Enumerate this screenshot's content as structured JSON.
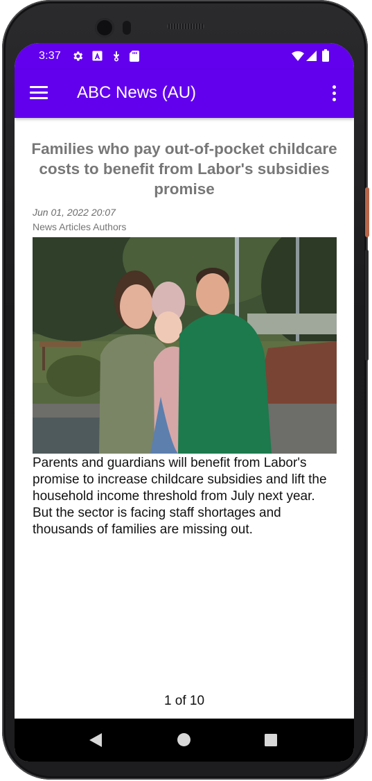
{
  "status_bar": {
    "time": "3:37",
    "left_icons": [
      "gear-icon",
      "a-letter-icon",
      "download-icon",
      "sd-card-icon"
    ],
    "right_icons": [
      "wifi-icon",
      "signal-icon",
      "battery-icon"
    ]
  },
  "app_bar": {
    "title": "ABC News (AU)",
    "menu_icon": "hamburger-menu-icon",
    "overflow_icon": "more-vert-icon"
  },
  "article": {
    "title": "Families who pay out-of-pocket childcare costs to benefit from Labor's subsidies promise",
    "date": "Jun 01, 2022 20:07",
    "author": "News Articles Authors",
    "summary": "Parents and guardians will benefit from Labor's promise to increase childcare subsidies and lift the household income threshold from July next year. But the sector is facing staff shortages and thousands of families are missing out."
  },
  "pager": {
    "text": "1 of 10",
    "current": 1,
    "total": 10
  },
  "nav_bar": {
    "buttons": [
      "back-icon",
      "home-icon",
      "recents-icon"
    ]
  },
  "colors": {
    "primary": "#6200ee",
    "headline": "#777777",
    "nav_bar": "#000000"
  }
}
